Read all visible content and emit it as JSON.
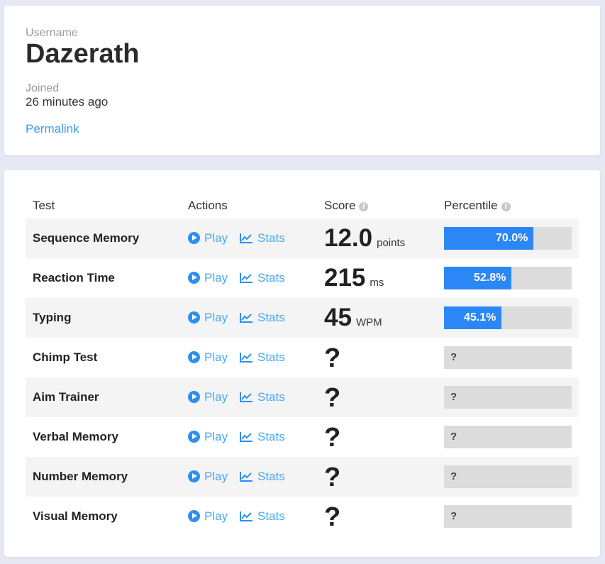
{
  "profile": {
    "username_label": "Username",
    "username": "Dazerath",
    "joined_label": "Joined",
    "joined": "26 minutes ago",
    "permalink": "Permalink"
  },
  "table": {
    "headers": {
      "test": "Test",
      "actions": "Actions",
      "score": "Score",
      "percentile": "Percentile",
      "info_icon": "i"
    },
    "play_label": "Play",
    "stats_label": "Stats",
    "unknown_mark": "?",
    "rows": [
      {
        "test": "Sequence Memory",
        "score": "12.0",
        "unit": "points",
        "percentile": 70.0,
        "percentile_label": "70.0%"
      },
      {
        "test": "Reaction Time",
        "score": "215",
        "unit": "ms",
        "percentile": 52.8,
        "percentile_label": "52.8%"
      },
      {
        "test": "Typing",
        "score": "45",
        "unit": "WPM",
        "percentile": 45.1,
        "percentile_label": "45.1%"
      },
      {
        "test": "Chimp Test",
        "score": null,
        "unit": null,
        "percentile": null,
        "percentile_label": "?"
      },
      {
        "test": "Aim Trainer",
        "score": null,
        "unit": null,
        "percentile": null,
        "percentile_label": "?"
      },
      {
        "test": "Verbal Memory",
        "score": null,
        "unit": null,
        "percentile": null,
        "percentile_label": "?"
      },
      {
        "test": "Number Memory",
        "score": null,
        "unit": null,
        "percentile": null,
        "percentile_label": "?"
      },
      {
        "test": "Visual Memory",
        "score": null,
        "unit": null,
        "percentile": null,
        "percentile_label": "?"
      }
    ]
  },
  "colors": {
    "page_background": "#e6e8f4",
    "accent_link": "#4aa8f0",
    "percentile_fill": "#2b87f6",
    "percentile_track": "#dcdcdc"
  },
  "icons": {
    "play": "play-circle-icon",
    "stats": "line-chart-icon",
    "info": "info-icon"
  }
}
